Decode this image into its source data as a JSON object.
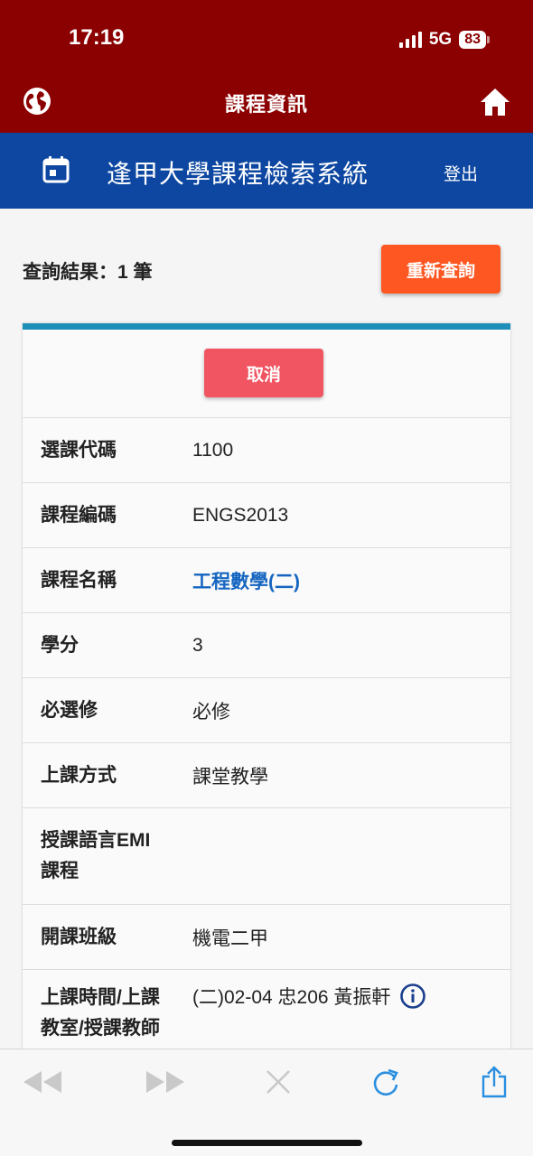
{
  "status": {
    "time": "17:19",
    "network": "5G",
    "battery": "83"
  },
  "header": {
    "title": "課程資訊"
  },
  "appbar": {
    "title": "逢甲大學課程檢索系統",
    "logout": "登出"
  },
  "result": {
    "label": "查詢結果：1 筆",
    "requery_button": "重新查詢"
  },
  "card": {
    "cancel_button": "取消",
    "rows": [
      {
        "label": "選課代碼",
        "value": "1100"
      },
      {
        "label": "課程編碼",
        "value": "ENGS2013"
      },
      {
        "label": "課程名稱",
        "value": "工程數學(二)"
      },
      {
        "label": "學分",
        "value": "3"
      },
      {
        "label": "必選修",
        "value": "必修"
      },
      {
        "label": "上課方式",
        "value": "課堂教學"
      },
      {
        "label": "授課語言EMI課程",
        "label_line1": "授課語言EMI",
        "label_line2": "課程",
        "value": ""
      },
      {
        "label": "開課班級",
        "value": "機電二甲"
      },
      {
        "label_line1": "上課時間/上課",
        "label_line2": "教室/授課教師",
        "value": "(二)02-04 忠206 黃振軒"
      }
    ]
  },
  "colors": {
    "header_red": "#8b0000",
    "appbar_blue": "#0d47a1",
    "requery_orange": "#ff5722",
    "cancel_red": "#f05561",
    "card_accent": "#1e8fb8",
    "link_blue": "#1565c0"
  },
  "icons": {
    "header_left": "globe-icon",
    "header_right": "home-icon",
    "appbar_left": "calendar-icon",
    "toolbar": [
      "back-icon",
      "forward-icon",
      "close-icon",
      "reload-icon",
      "share-icon"
    ]
  }
}
